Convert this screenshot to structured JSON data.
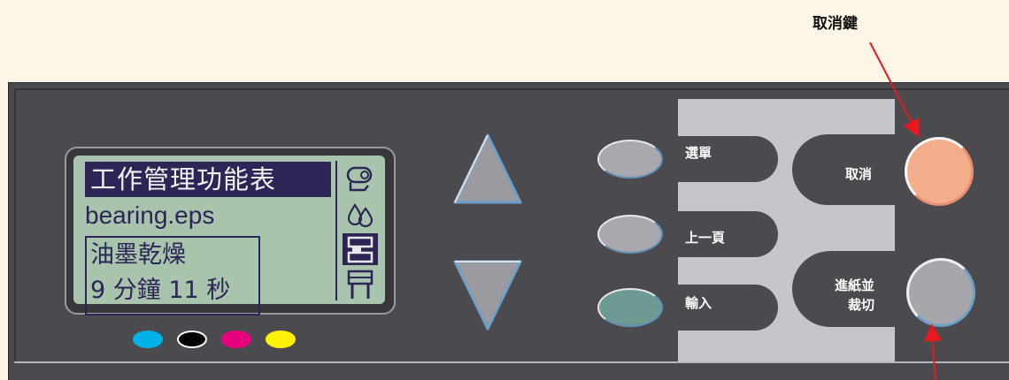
{
  "callouts": {
    "cancel_key": "取消鍵"
  },
  "lcd": {
    "title": "工作管理功能表",
    "filename": "bearing.eps",
    "status_line1": "油墨乾燥",
    "status_line2": "9 分鐘 11 秒",
    "side_icons": [
      "paper-roll-icon",
      "ink-drops-icon",
      "job-queue-icon",
      "printer-icon"
    ],
    "selected_icon": "job-queue-icon"
  },
  "ink_indicators": [
    {
      "name": "cyan",
      "color": "#00b0e8"
    },
    {
      "name": "black",
      "color": "#000000"
    },
    {
      "name": "magenta",
      "color": "#e8007c"
    },
    {
      "name": "yellow",
      "color": "#fff200"
    }
  ],
  "buttons": {
    "menu": "選單",
    "previous_page": "上一頁",
    "enter": "輸入",
    "cancel": "取消",
    "feed_cut_line1": "進紙並",
    "feed_cut_line2": "裁切"
  },
  "colors": {
    "panel": "#4a4a4f",
    "lcd_background": "#a9c4ac",
    "lcd_ink": "#2c2555",
    "cancel_button": "#f4ad8a",
    "arrow": "#e8191e"
  }
}
